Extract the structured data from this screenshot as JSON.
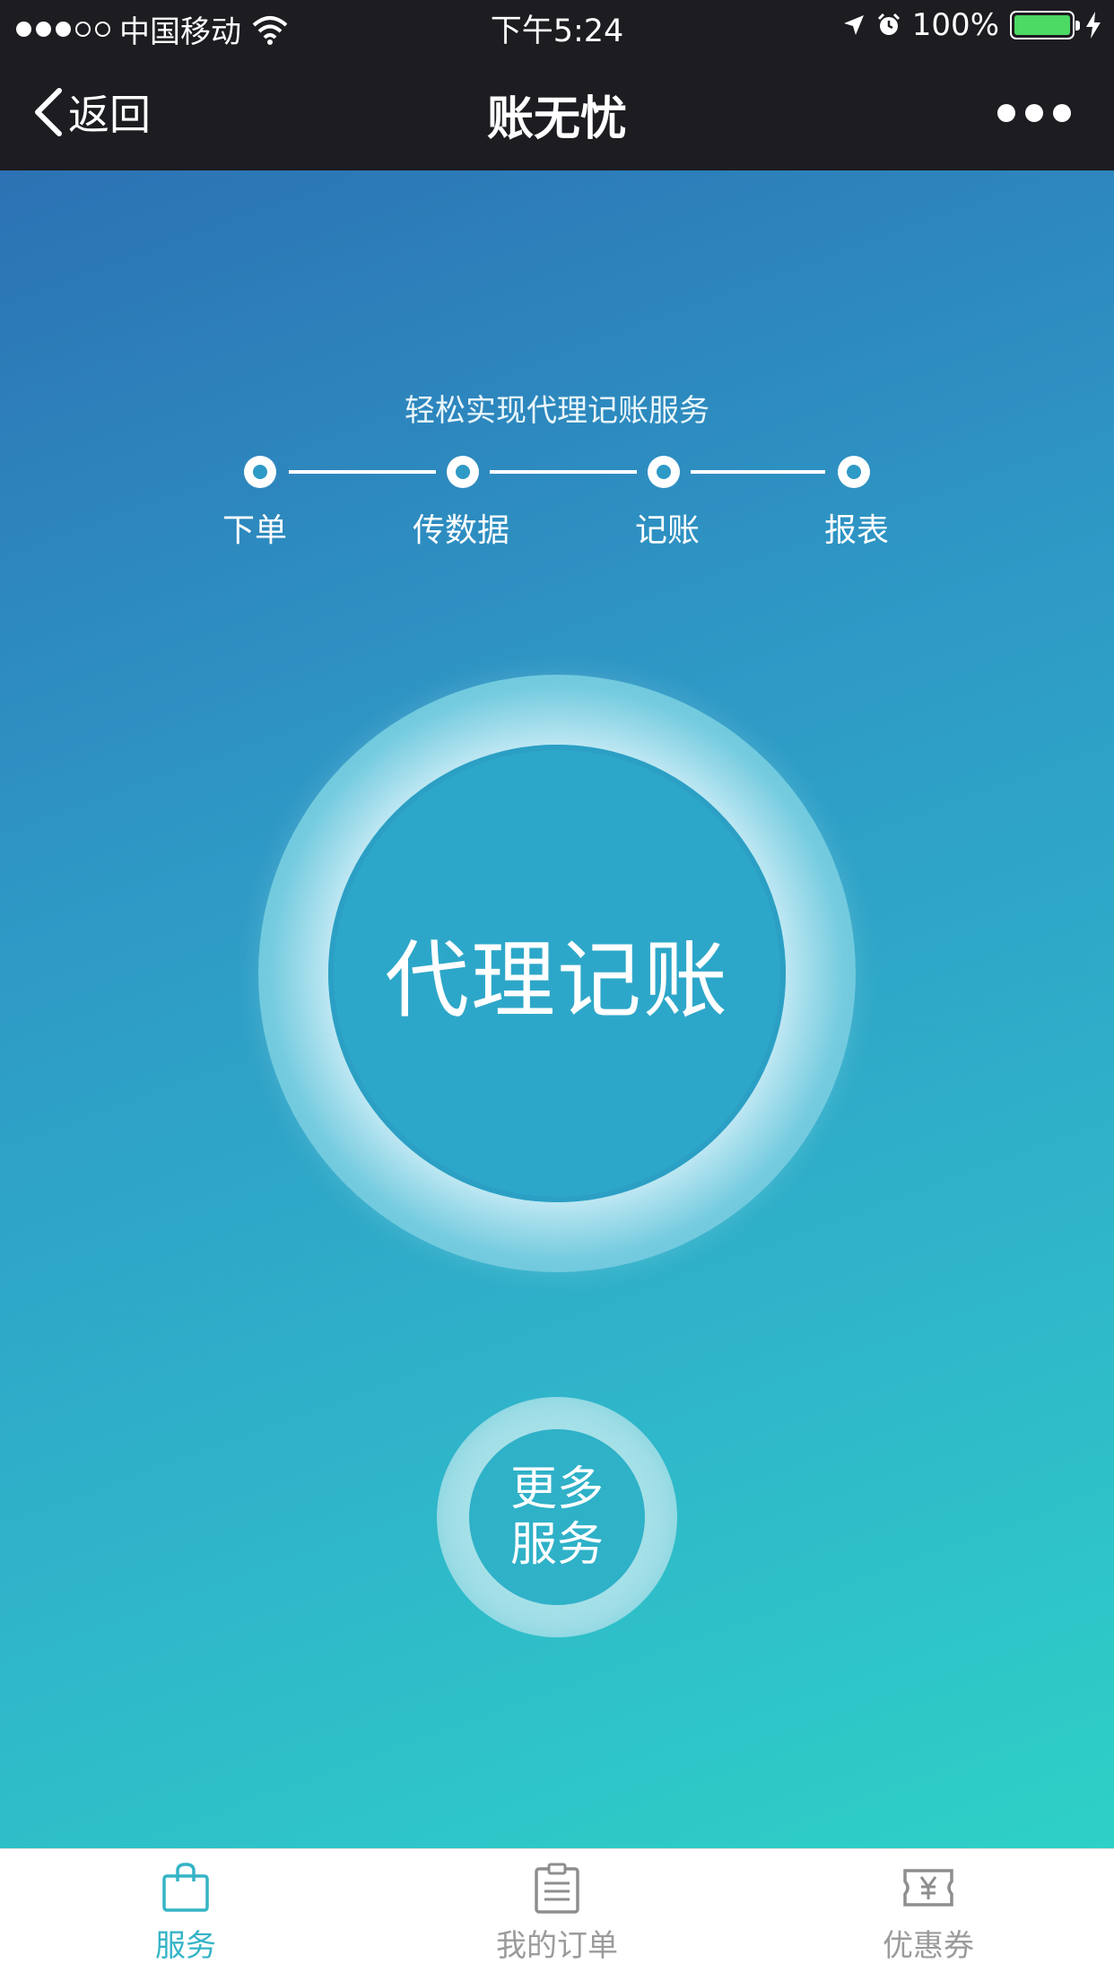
{
  "status_bar": {
    "carrier": "中国移动",
    "time": "下午5:24",
    "battery": "100%"
  },
  "nav": {
    "back_label": "返回",
    "title": "账无忧"
  },
  "hero": {
    "subtitle": "轻松实现代理记账服务",
    "steps": [
      "下单",
      "传数据",
      "记账",
      "报表"
    ],
    "main_button": "代理记账",
    "more_button_line1": "更多",
    "more_button_line2": "服务"
  },
  "tabs": [
    {
      "label": "服务",
      "icon": "shopping-bag-icon",
      "active": true
    },
    {
      "label": "我的订单",
      "icon": "clipboard-icon",
      "active": false
    },
    {
      "label": "优惠券",
      "icon": "coupon-yen-icon",
      "active": false
    }
  ],
  "colors": {
    "accent": "#35b4c6",
    "battery": "#4cd964",
    "header_bg": "#1c1c21"
  }
}
